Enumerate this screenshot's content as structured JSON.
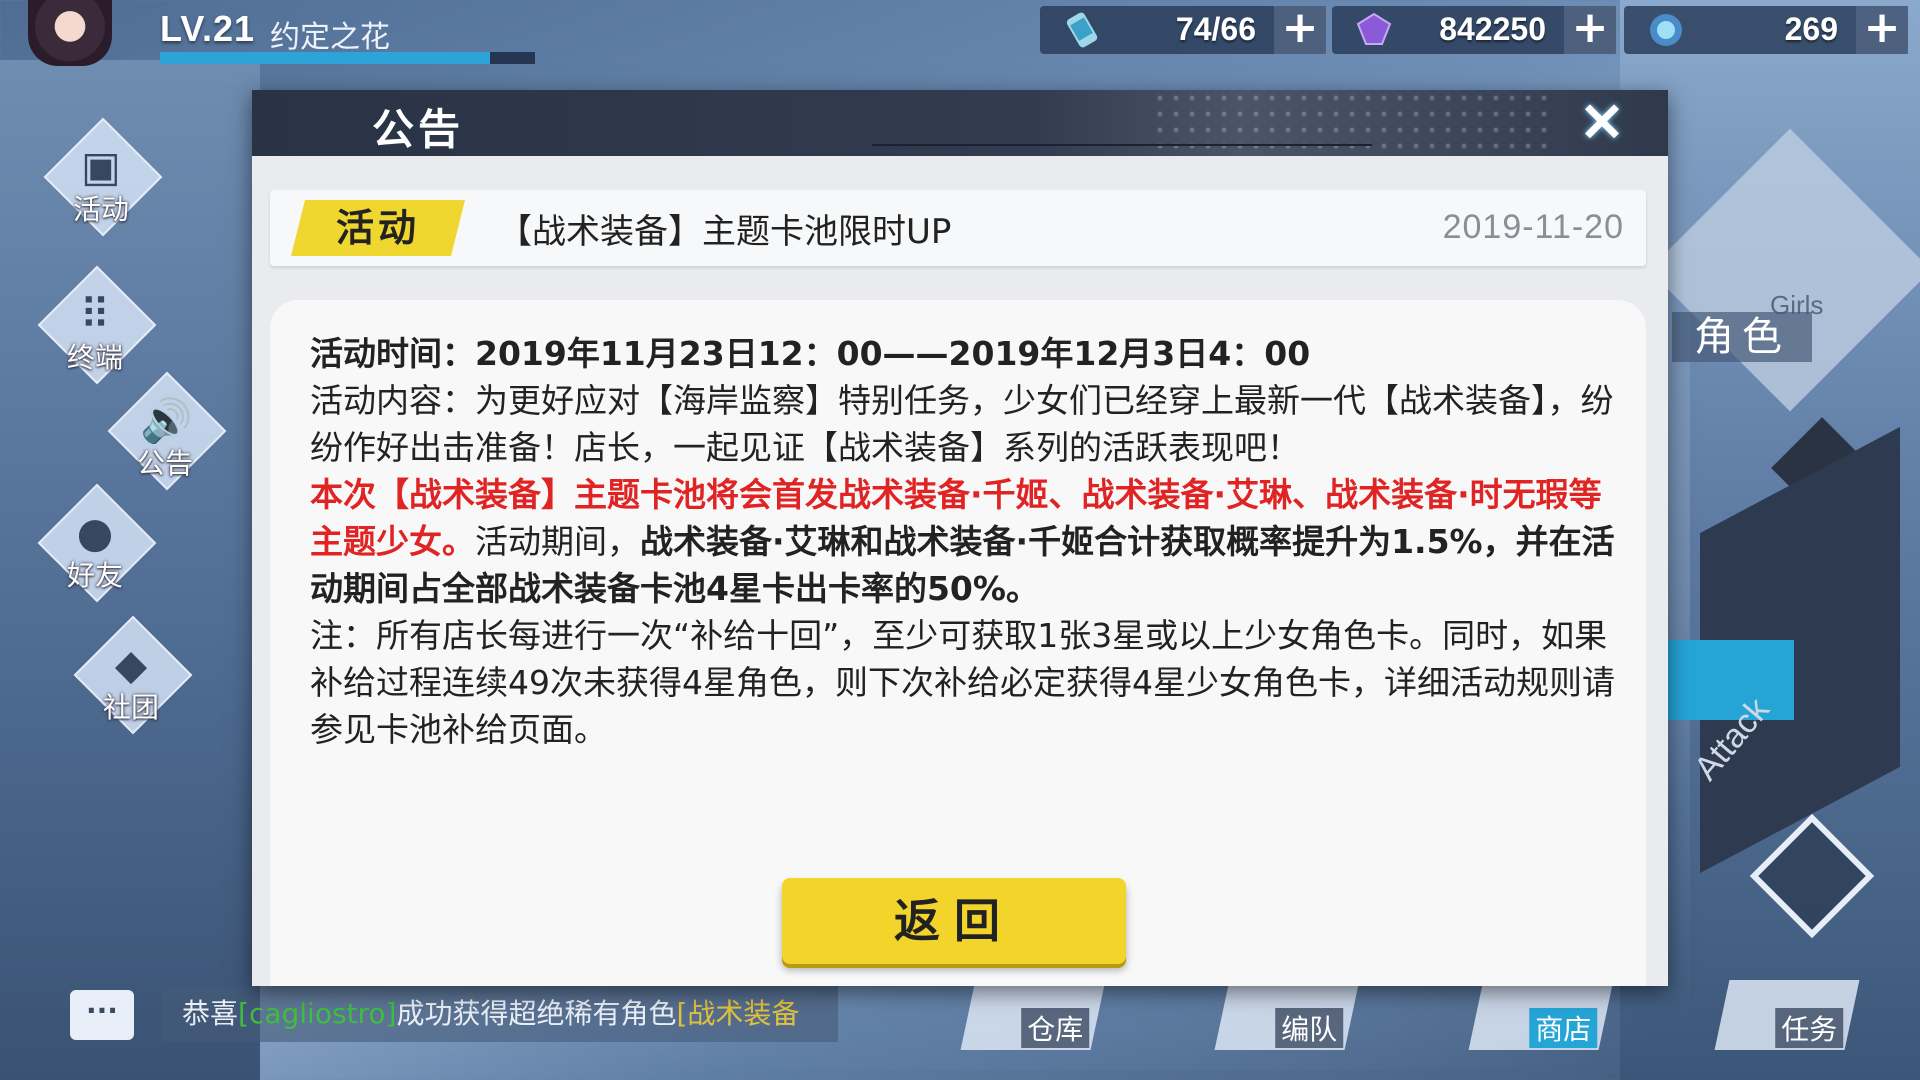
{
  "player": {
    "level": "LV.21",
    "name": "约定之花",
    "xp_fraction": 0.88
  },
  "resources": [
    {
      "icon": "stamina-potion-icon",
      "value": "74/66"
    },
    {
      "icon": "purple-gem-icon",
      "value": "842250"
    },
    {
      "icon": "crystal-orb-icon",
      "value": "269"
    }
  ],
  "left_menu": [
    {
      "name": "activity",
      "label": "活动",
      "icon": "robot-icon"
    },
    {
      "name": "terminal",
      "label": "终端",
      "icon": "keypad-icon"
    },
    {
      "name": "announcement",
      "label": "公告",
      "icon": "speaker-icon"
    },
    {
      "name": "friends",
      "label": "好友",
      "icon": "person-icon"
    },
    {
      "name": "club",
      "label": "社团",
      "icon": "club-icon"
    }
  ],
  "right_menu": {
    "role_label": "角色",
    "girls_label": "Girls",
    "attack_label": "Attack"
  },
  "bottom": {
    "ticker_prefix": "恭喜",
    "ticker_player": "[cagliostro]",
    "ticker_mid": "成功获得超绝稀有角色",
    "ticker_item": "[战术装备",
    "buttons": [
      "仓库",
      "编队",
      "商店",
      "任务"
    ]
  },
  "modal": {
    "title": "公告",
    "close_label": "✕",
    "tag": "活动",
    "notice_title": "【战术装备】主题卡池限时UP",
    "notice_date": "2019-11-20",
    "time_line": "活动时间：2019年11月23日12：00——2019年12月3日4：00",
    "content_line": "活动内容：为更好应对【海岸监察】特别任务，少女们已经穿上最新一代【战术装备】，纷纷作好出击准备！店长，一起见证【战术装备】系列的活跃表现吧！",
    "red_line": "本次【战术装备】主题卡池将会首发战术装备·千姬、战术装备·艾琳、战术装备·时无瑕等主题少女。",
    "mid_text": "活动期间，",
    "bold_line": "战术装备·艾琳和战术装备·千姬合计获取概率提升为1.5%，并在活动期间占全部战术装备卡池4星卡出卡率的50%。",
    "note_line": "注：所有店长每进行一次“补给十回”，至少可获取1张3星或以上少女角色卡。同时，如果补给过程连续49次未获得4星角色，则下次补给必定获得4星少女角色卡，详细活动规则请参见卡池补给页面。",
    "return_label": "返回"
  },
  "colors": {
    "accent_yellow": "#f3d42b",
    "alert_red": "#e02424",
    "header_dark": "#2a3345",
    "shop_blue": "#25a4d6"
  }
}
